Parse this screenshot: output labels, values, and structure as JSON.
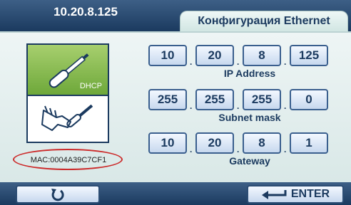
{
  "header": {
    "ip_address": "10.20.8.125",
    "tab_title": "Конфигурация Ethernet"
  },
  "mode": {
    "dhcp_label": "DHCP",
    "dhcp_icon": "screwdriver-icon",
    "manual_icon": "hand-screwdriver-icon",
    "active_mode": "DHCP"
  },
  "mac_label": "MAC:0004A39C7CF1",
  "ip_address": {
    "label": "IP Address",
    "octets": [
      "10",
      "20",
      "8",
      "125"
    ]
  },
  "subnet_mask": {
    "label": "Subnet mask",
    "octets": [
      "255",
      "255",
      "255",
      "0"
    ]
  },
  "gateway": {
    "label": "Gateway",
    "octets": [
      "10",
      "20",
      "8",
      "1"
    ]
  },
  "footer": {
    "back_icon": "rotate-back-icon",
    "enter_label": "ENTER",
    "enter_icon": "enter-arrow-icon"
  },
  "colors": {
    "bar_blue": "#1b3a5f",
    "dhcp_green": "#6ea83a",
    "highlight_red": "#cc2a2a"
  }
}
